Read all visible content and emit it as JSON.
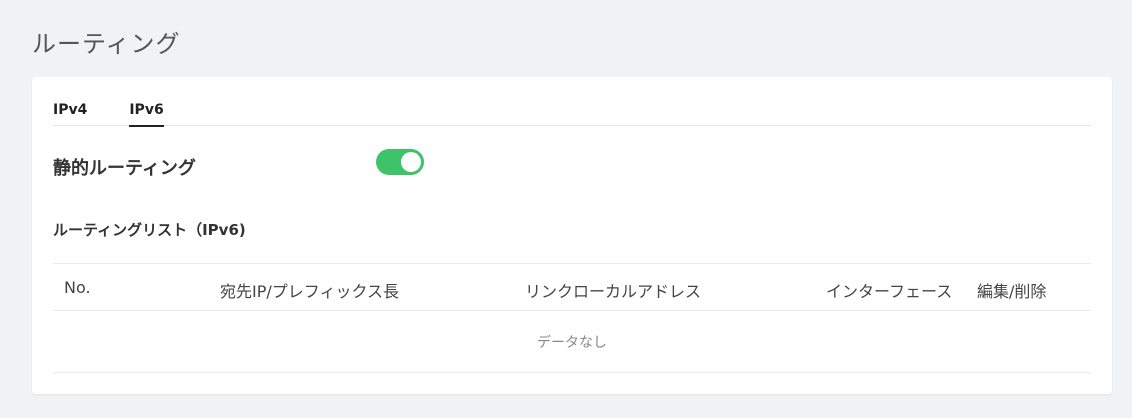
{
  "page": {
    "title": "ルーティング"
  },
  "tabs": [
    {
      "label": "IPv4",
      "active": false
    },
    {
      "label": "IPv6",
      "active": true
    }
  ],
  "static_routing": {
    "label": "静的ルーティング",
    "enabled": true,
    "toggle_color": "#3fc36a"
  },
  "routing_list": {
    "title": "ルーティングリスト（IPv6)",
    "columns": [
      "No.",
      "宛先IP/プレフィックス長",
      "リンクローカルアドレス",
      "インターフェース",
      "編集/削除"
    ],
    "rows": [],
    "empty_text": "データなし"
  }
}
